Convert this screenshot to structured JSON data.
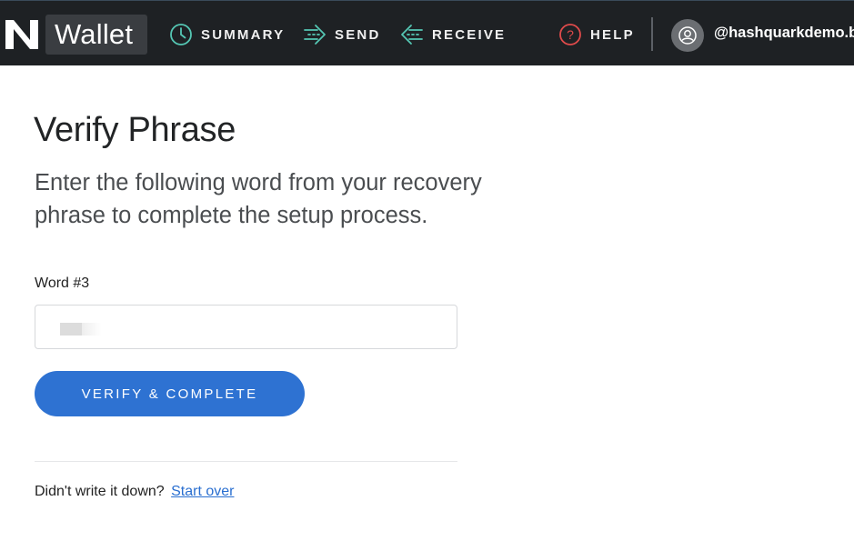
{
  "nav": {
    "brand": "Wallet",
    "items": [
      {
        "label": "SUMMARY",
        "icon": "clock-icon"
      },
      {
        "label": "SEND",
        "icon": "send-arrow-icon"
      },
      {
        "label": "RECEIVE",
        "icon": "receive-arrow-icon"
      },
      {
        "label": "HELP",
        "icon": "question-circle-icon"
      }
    ],
    "username": "@hashquarkdemo.bo"
  },
  "main": {
    "title": "Verify Phrase",
    "subtitle": "Enter the following word from your recovery phrase to complete the setup process.",
    "field_label": "Word #3",
    "verify_button": "VERIFY & COMPLETE",
    "footer_prompt": "Didn't write it down?",
    "footer_link": "Start over"
  },
  "colors": {
    "nav_bg": "#1e2124",
    "brand_box": "#3a3d41",
    "primary": "#2e72d2",
    "help_icon": "#e04b4b",
    "link": "#2a6fd0"
  }
}
